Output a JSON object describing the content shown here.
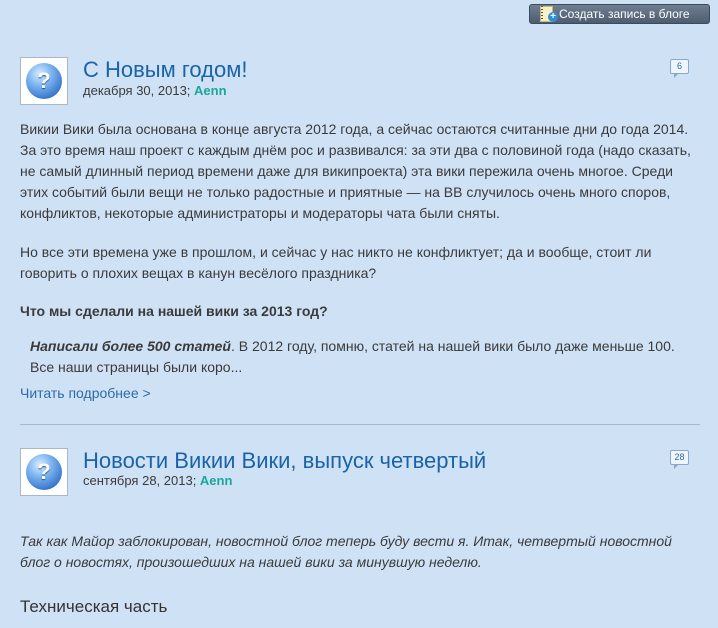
{
  "toolbar": {
    "create_post_label": "Создать запись в блоге"
  },
  "post1": {
    "title": "С Новым годом!",
    "date": "декабря 30, 2013; ",
    "author": "Aenn",
    "comments": "6",
    "p1": "Викии Вики была основана в конце августа 2012 года, а сейчас остаются считанные дни до года 2014. За это время наш проект с каждым днём рос и развивался: за эти два с половиной года (надо сказать, не самый длинный период времени даже для википроекта) эта вики пережила очень многое. Среди этих событий были вещи не только радостные и приятные — на ВВ случилось очень много споров, конфликтов, некоторые администраторы и модераторы чата были сняты.",
    "p2": "Но все эти времена уже в прошлом, и сейчас у нас никто не конфликтует; да и вообще, стоит ли говорить о плохих вещах в канун весёлого праздника?",
    "question": "Что мы сделали на нашей вики за 2013 год?",
    "quote_bold": "Написали более 500 статей",
    "quote_rest": ". В 2012 году, помню, статей на нашей вики было даже меньше 100. Все наши страницы были коро...",
    "read_more": "Читать подробнее >"
  },
  "post2": {
    "title": "Новости Викии Вики, выпуск четвертый",
    "date": "сентября 28, 2013; ",
    "author": "Aenn",
    "comments": "28",
    "intro": "Так как Майор заблокирован, новостной блог теперь буду вести я. Итак, четвертый новостной блог о новостях, произошедших на нашей вики за минувшую неделю.",
    "section": "Техническая часть"
  }
}
